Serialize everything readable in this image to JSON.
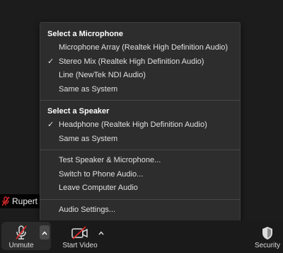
{
  "participant": {
    "name": "Rupert I"
  },
  "menu": {
    "microphone_header": "Select a Microphone",
    "microphones": [
      {
        "label": "Microphone Array (Realtek High Definition Audio)",
        "checked": false
      },
      {
        "label": "Stereo Mix (Realtek High Definition Audio)",
        "checked": true
      },
      {
        "label": "Line (NewTek NDI Audio)",
        "checked": false
      },
      {
        "label": "Same as System",
        "checked": false
      }
    ],
    "speaker_header": "Select a Speaker",
    "speakers": [
      {
        "label": "Headphone (Realtek High Definition Audio)",
        "checked": true
      },
      {
        "label": "Same as System",
        "checked": false
      }
    ],
    "actions": [
      {
        "label": "Test Speaker & Microphone..."
      },
      {
        "label": "Switch to Phone Audio..."
      },
      {
        "label": "Leave Computer Audio"
      }
    ],
    "settings": {
      "label": "Audio Settings..."
    },
    "check_glyph": "✓"
  },
  "toolbar": {
    "unmute_label": "Unmute",
    "start_video_label": "Start Video",
    "security_label": "Security"
  },
  "colors": {
    "mute_red": "#e02828",
    "menu_bg": "#2d2d2d"
  }
}
